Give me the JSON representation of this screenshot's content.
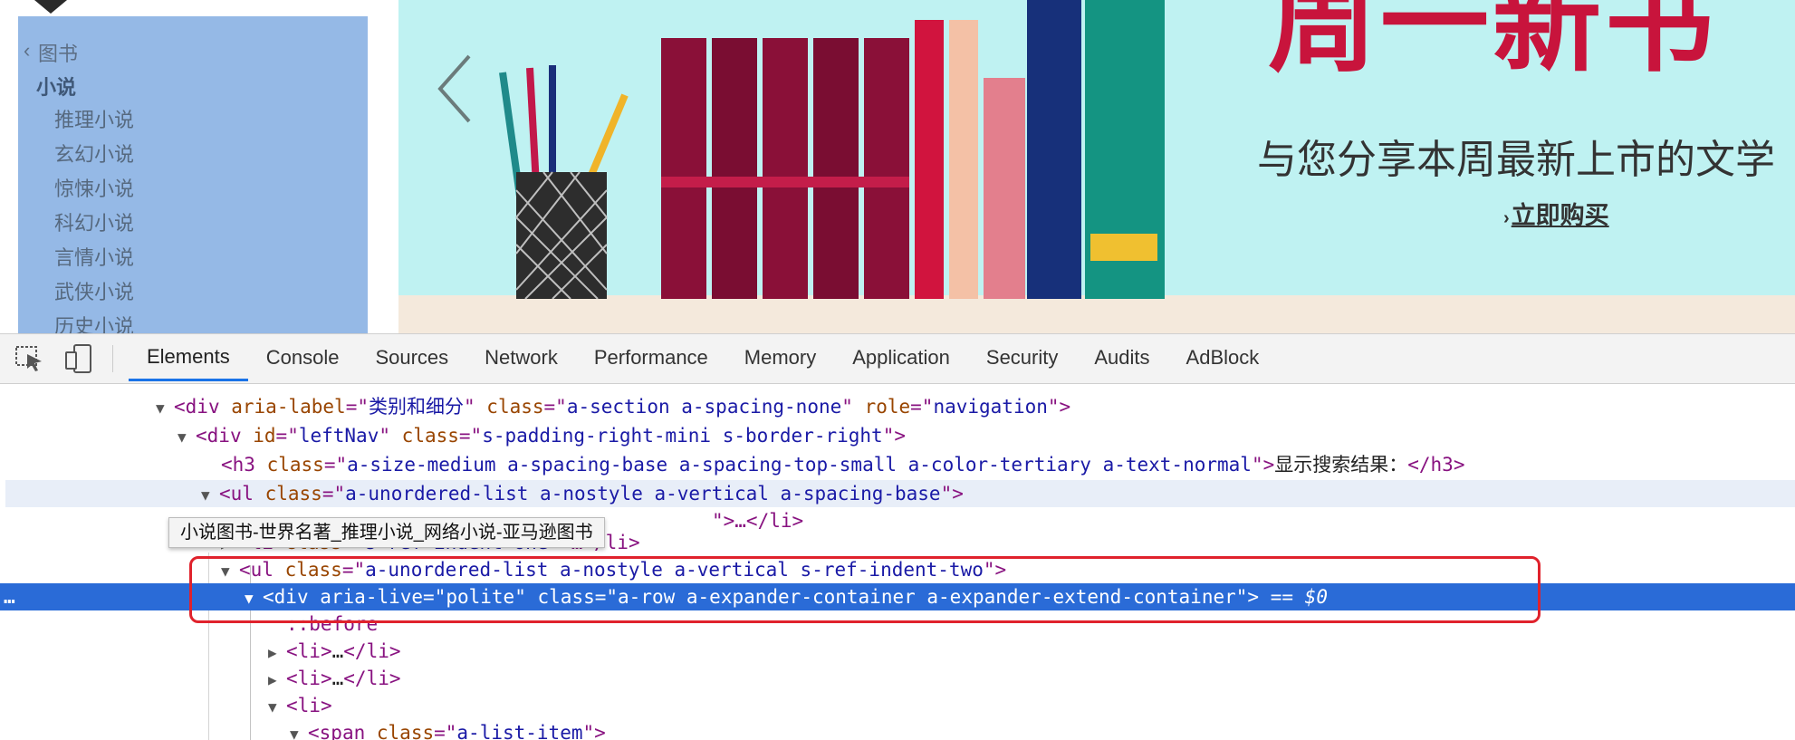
{
  "category_nav": {
    "back_label": "图书",
    "current": "小说",
    "items": [
      "推理小说",
      "玄幻小说",
      "惊悚小说",
      "科幻小说",
      "言情小说",
      "武侠小说",
      "历史小说"
    ]
  },
  "banner": {
    "headline": "周一新书",
    "subtitle": "与您分享本周最新上市的文学",
    "cta": "立即购买",
    "cta_arrow": "›"
  },
  "devtools": {
    "tabs": [
      "Elements",
      "Console",
      "Sources",
      "Network",
      "Performance",
      "Memory",
      "Application",
      "Security",
      "Audits",
      "AdBlock"
    ],
    "active_tab": "Elements",
    "tooltip": "小说图书-世界名著_推理小说_网络小说-亚马逊图书",
    "dom": {
      "row1": {
        "tag": "div",
        "a1": "aria-label",
        "v1": "类别和细分",
        "a2": "class",
        "v2": "a-section a-spacing-none",
        "a3": "role",
        "v3": "navigation"
      },
      "row2": {
        "tag": "div",
        "a1": "id",
        "v1": "leftNav",
        "a2": "class",
        "v2": "s-padding-right-mini s-border-right"
      },
      "row3": {
        "tag": "h3",
        "a1": "class",
        "v1": "a-size-medium a-spacing-base a-spacing-top-small a-color-tertiary a-text-normal",
        "text": "显示搜索结果："
      },
      "row4": {
        "tag": "ul",
        "a1": "class",
        "v1": "a-unordered-list a-nostyle a-vertical a-spacing-base"
      },
      "row5": {
        "tail": "\">…</li>"
      },
      "row6": {
        "tag": "li",
        "a1": "class",
        "v1": "s-ref-indent-one"
      },
      "row7": {
        "tag": "ul",
        "a1": "class",
        "v1": "a-unordered-list a-nostyle a-vertical s-ref-indent-two"
      },
      "row8": {
        "tag": "div",
        "a1": "aria-live",
        "v1": "polite",
        "a2": "class",
        "v2": "a-row a-expander-container a-expander-extend-container",
        "eq": "==",
        "dollar": "$0"
      },
      "row9": {
        "pseudo": "::before"
      },
      "row10": {
        "tag": "li",
        "collapsed": "…"
      },
      "row11": {
        "tag": "li",
        "collapsed": "…"
      },
      "row12": {
        "tag": "li"
      },
      "row13": {
        "tag": "span",
        "a1": "class",
        "v1": "a-list-item"
      }
    }
  },
  "colors": {
    "selected_row": "#2a6bd7",
    "highlight_box": "#e0222c",
    "banner_bg": "#bff2f2",
    "category_bg": "#95b9e6",
    "headline": "#c8143c"
  }
}
